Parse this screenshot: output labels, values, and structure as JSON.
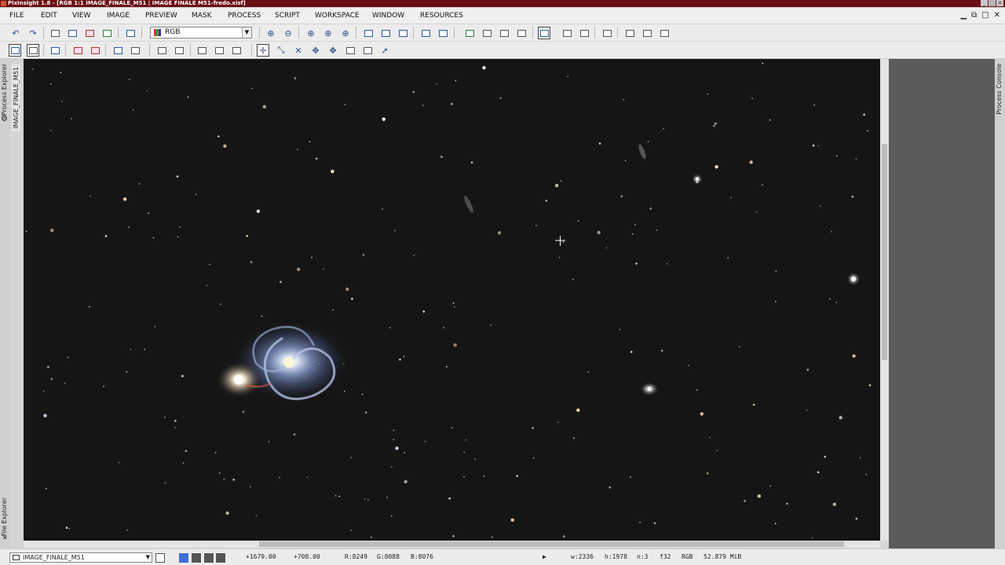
{
  "window": {
    "title": "PixInsight 1.8 - [RGB 1:1 IMAGE_FINALE_M51 | IMAGE FINALE M51-fredo.xisf]",
    "controls": [
      "_",
      "□",
      "✕"
    ]
  },
  "menu": {
    "items": [
      "FILE",
      "EDIT",
      "VIEW",
      "IMAGE",
      "PREVIEW",
      "MASK",
      "PROCESS",
      "SCRIPT",
      "WORKSPACE",
      "WINDOW",
      "RESOURCES"
    ]
  },
  "mdi_controls": [
    "▁",
    "⧉",
    "□",
    "✕"
  ],
  "toolbar": {
    "channel_select": "RGB"
  },
  "side_tabs": {
    "process_explorer": "Process Explorer",
    "image_tab": "IMAGE_FINALE_M51",
    "file_explorer": "File Explorer",
    "process_console": "Process Console"
  },
  "status": {
    "view_name": "IMAGE_FINALE_M51",
    "cursor_x": "+1679.00",
    "cursor_y": "+708.00",
    "r_value": "R:8249",
    "g_value": "G:8088",
    "b_value": "B:8076",
    "play_icon": "▶",
    "width": "w:2336",
    "height": "h:1978",
    "channels": "n:3",
    "sample_format": "f32",
    "color_space": "RGB",
    "memory": "52.879 MiB"
  },
  "colors": {
    "title_bg": "#6a0d12",
    "sky_bg": "#151515",
    "toolbar_bg": "#ececec",
    "workspace_bg": "#5b5b5b"
  },
  "icons": {
    "undo": "undo-icon",
    "redo": "redo-icon",
    "zoom_in": "zoom-in-icon",
    "zoom_out": "zoom-out-icon",
    "pan": "pan-icon",
    "select": "pointer-icon",
    "crosshair": "crosshair-cursor-icon"
  }
}
